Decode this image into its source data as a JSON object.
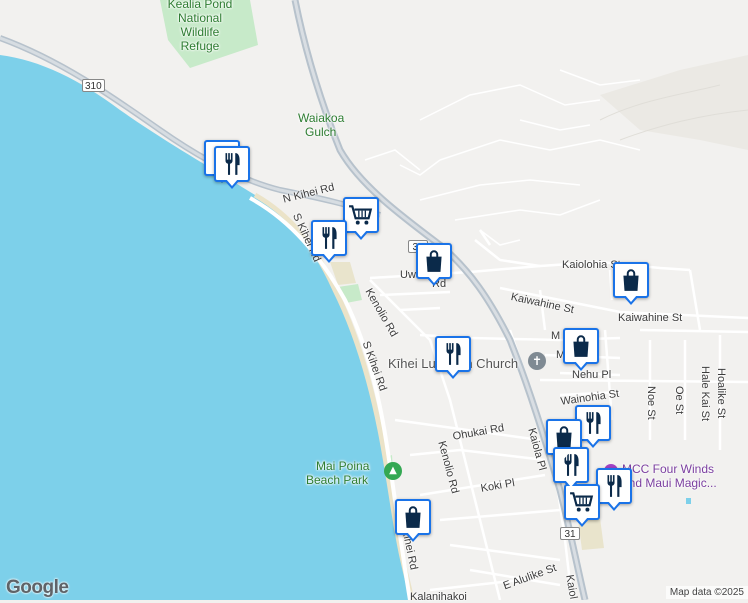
{
  "map": {
    "colors": {
      "water": "#7dd0ea",
      "land": "#f2f1ef",
      "park": "#c7eac9",
      "road": "#ffffff",
      "highway": "#b7c2cc",
      "pin_border": "#1a73e8",
      "pin_icon": "#0b2a4a"
    },
    "labels": {
      "refuge": "Kealia Pond National Wildlife Refuge",
      "gulch_line1": "Waiakoa",
      "gulch_line2": "Gulch",
      "n_kihei_rd": "N Kihei Rd",
      "s_kihei_rd_1": "S Kihei Rd",
      "s_kihei_rd_2": "S Kihei Rd",
      "s_kihei_rd_3": "Kihei Rd",
      "uwapo_a": "Uwa",
      "uwapo_b": "Rd",
      "kenolio_rd_1": "Kenolio Rd",
      "kenolio_rd_2": "Kenolio Rd",
      "kaiolohia": "Kaiolohia St",
      "kaiwahine_1": "Kaiwahine St",
      "kaiwahine_2": "Kaiwahine St",
      "church": "Kīhei Lutheran Church",
      "nehu": "Nehu Pl",
      "wainohia": "Wainohia St",
      "noe": "Noe St",
      "oe": "Oe St",
      "hale_kai": "Hale Kai St",
      "hoalike": "Hoalike St",
      "ohukai": "Ohukai Rd",
      "kaiola": "Kaiola Pl",
      "koki": "Koki Pl",
      "e_alulike": "E Alulike St",
      "kaiol_bottom": "Kaiol",
      "kalanihakoi": "Kalanihakoi",
      "mai_poina_line1": "Mai Poina",
      "mai_poina_line2": "Beach Park",
      "mcc_line1": "MCC Four Winds",
      "mcc_line2": "and Maui Magic...",
      "m_a": "M",
      "m_b": "M"
    },
    "shields": {
      "hwy310": "310",
      "hwy31_a": "31",
      "hwy31_b": "31"
    },
    "pins": [
      {
        "name": "restaurant",
        "type": "restaurant"
      },
      {
        "name": "grocery",
        "type": "grocery"
      },
      {
        "name": "restaurant",
        "type": "restaurant"
      },
      {
        "name": "shopping",
        "type": "shopping"
      },
      {
        "name": "shopping",
        "type": "shopping"
      },
      {
        "name": "restaurant",
        "type": "restaurant"
      },
      {
        "name": "shopping",
        "type": "shopping"
      },
      {
        "name": "restaurant",
        "type": "restaurant"
      },
      {
        "name": "shopping",
        "type": "shopping"
      },
      {
        "name": "restaurant",
        "type": "restaurant"
      },
      {
        "name": "restaurant",
        "type": "restaurant"
      },
      {
        "name": "grocery",
        "type": "grocery"
      },
      {
        "name": "shopping",
        "type": "shopping"
      }
    ],
    "brand": "Google",
    "attribution": "Map data ©2025"
  }
}
